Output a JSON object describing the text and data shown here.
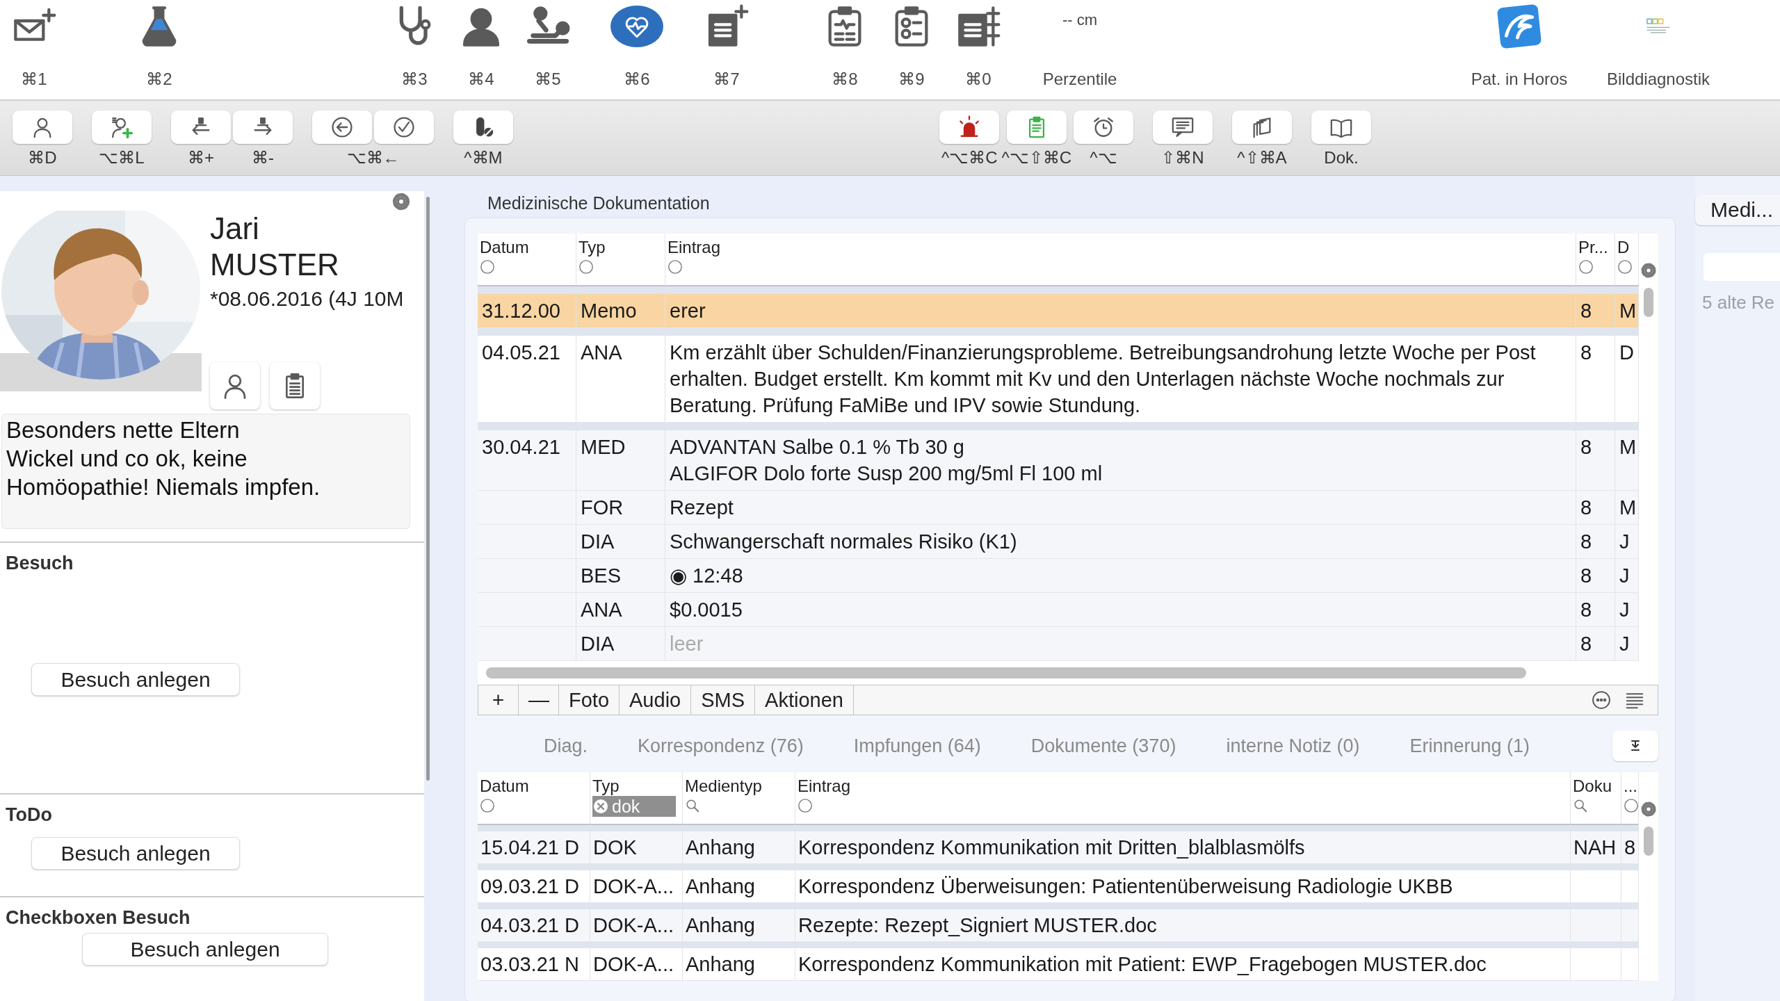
{
  "top_toolbar": {
    "groups": [
      [
        {
          "label": "⌘1",
          "selected": false
        }
      ],
      [
        {
          "label": "⌘2",
          "selected": false
        }
      ],
      [
        {
          "label": "⌘3",
          "selected": false
        },
        {
          "label": "⌘4",
          "selected": false
        },
        {
          "label": "⌘5",
          "selected": false
        }
      ],
      [
        {
          "label": "⌘6",
          "selected": true
        }
      ],
      [
        {
          "label": "⌘7",
          "selected": false
        }
      ],
      [
        {
          "label": "⌘8",
          "selected": false
        },
        {
          "label": "⌘9",
          "selected": false
        },
        {
          "label": "⌘0",
          "selected": false
        }
      ],
      [
        {
          "label": "Perzentile",
          "value": "-- cm",
          "selected": false
        }
      ],
      [
        {
          "label": "Pat. in Horos",
          "selected": false
        },
        {
          "label": "Bilddiagnostik",
          "selected": false
        }
      ]
    ]
  },
  "action_bar": {
    "left": [
      {
        "kind": "each",
        "labels": [
          "⌘D"
        ]
      },
      {
        "kind": "each",
        "labels": [
          "⌥⌘L"
        ]
      },
      {
        "kind": "each",
        "labels": [
          "⌘+",
          "⌘-"
        ]
      },
      {
        "kind": "shared",
        "labels": [
          "⌥⌘←"
        ]
      },
      {
        "kind": "each",
        "labels": [
          "^⌘M"
        ]
      }
    ],
    "right": [
      {
        "kind": "each",
        "labels": [
          "^⌥⌘C",
          "^⌥⇧⌘C",
          "^⌥"
        ]
      },
      {
        "kind": "each",
        "labels": [
          "⇧⌘N"
        ]
      },
      {
        "kind": "each",
        "labels": [
          "^⇧⌘A"
        ]
      },
      {
        "kind": "each",
        "labels": [
          "Dok."
        ]
      }
    ]
  },
  "patient": {
    "first_name": "Jari",
    "last_name": "MUSTER",
    "birth": "*08.06.2016 (4J 10M",
    "notes": "Besonders nette Eltern\nWickel und co ok, keine\nHomöopathie! Niemals impfen."
  },
  "sections": [
    {
      "kind": "tall",
      "title": "Besuch",
      "button": "Besuch anlegen"
    },
    {
      "kind": "compact",
      "title": "ToDo",
      "button": "Besuch anlegen"
    },
    {
      "kind": "centered",
      "title": "Checkboxen Besuch",
      "button": "Besuch anlegen"
    }
  ],
  "documentation": {
    "title": "Medizinische Dokumentation",
    "table": {
      "columns": [
        {
          "label": "Datum",
          "kind": "circle"
        },
        {
          "label": "Typ",
          "kind": "circle"
        },
        {
          "label": "Eintrag",
          "kind": "circle"
        },
        {
          "label": "Pr...",
          "kind": "circle"
        },
        {
          "label": "D",
          "kind": "circle"
        }
      ],
      "rows": [
        {
          "cells": [
            "31.12.00",
            "Memo",
            "erer",
            "8",
            "M"
          ],
          "selected": true,
          "muted": false
        },
        {
          "cells": [
            "04.05.21",
            "ANA",
            "Km erzählt über Schulden/Finanzierungsprobleme. Betreibungsandrohung letzte Woche per Post erhalten. Budget erstellt. Km kommt mit Kv und den Unterlagen nächste Woche nochmals zur Beratung. Prüfung FaMiBe und IPV sowie Stundung.",
            "8",
            "D"
          ],
          "selected": false,
          "muted": false
        },
        {
          "cells": [
            "30.04.21",
            "MED",
            "ADVANTAN Salbe 0.1 % Tb 30 g\nALGIFOR Dolo forte Susp 200 mg/5ml Fl 100 ml",
            "8",
            "M"
          ],
          "selected": false,
          "muted": false
        },
        {
          "cells": [
            null,
            "FOR",
            "Rezept",
            "8",
            "M"
          ],
          "selected": false,
          "muted": false
        },
        {
          "cells": [
            null,
            "DIA",
            "Schwangerschaft normales Risiko (K1)",
            "8",
            "J"
          ],
          "selected": false,
          "muted": false
        },
        {
          "cells": [
            null,
            "BES",
            "◉ 12:48",
            "8",
            "J"
          ],
          "selected": false,
          "muted": false
        },
        {
          "cells": [
            null,
            "ANA",
            "$0.0015",
            "8",
            "J"
          ],
          "selected": false,
          "muted": false
        },
        {
          "cells": [
            null,
            "DIA",
            "leer",
            "8",
            "J"
          ],
          "selected": false,
          "muted": true
        }
      ]
    },
    "toolbar": [
      "+",
      "—",
      "Foto",
      "Audio",
      "SMS",
      "Aktionen"
    ],
    "tabs": [
      {
        "label": "Diag.",
        "selected": false
      },
      {
        "label": "Korrespondenz (76)",
        "selected": false
      },
      {
        "label": "Impfungen (64)",
        "selected": false
      },
      {
        "label": "Dokumente (370)",
        "selected": false
      },
      {
        "label": "interne Notiz (0)",
        "selected": false
      },
      {
        "label": "Erinnerung (1)",
        "selected": false
      }
    ],
    "lower_table": {
      "columns": [
        {
          "label": "Datum",
          "kind": "circle"
        },
        {
          "label": "Typ",
          "kind": "chip",
          "filter_value": "dok"
        },
        {
          "label": "Medientyp",
          "kind": "search"
        },
        {
          "label": "Eintrag",
          "kind": "circle"
        },
        {
          "label": "Doku",
          "kind": "search"
        },
        {
          "label": "...",
          "kind": "circle"
        }
      ],
      "rows": [
        {
          "cells": [
            "15.04.21 D",
            "DOK",
            "Anhang",
            "Korrespondenz Kommunikation mit Dritten_blalblasmölfs",
            "NAH",
            "8"
          ]
        },
        {
          "cells": [
            "09.03.21 D",
            "DOK-A...",
            "Anhang",
            "Korrespondenz Überweisungen: Patientenüberweisung Radiologie UKBB"
          ]
        },
        {
          "cells": [
            "04.03.21 D",
            "DOK-A...",
            "Anhang",
            "Rezepte: Rezept_Signiert MUSTER.doc"
          ]
        },
        {
          "cells": [
            "03.03.21 N",
            "DOK-A...",
            "Anhang",
            "Korrespondenz Kommunikation mit Patient: EWP_Fragebogen MUSTER.doc"
          ]
        }
      ]
    }
  },
  "right_panel": {
    "button": "Medi...",
    "note": "5 alte Re"
  }
}
